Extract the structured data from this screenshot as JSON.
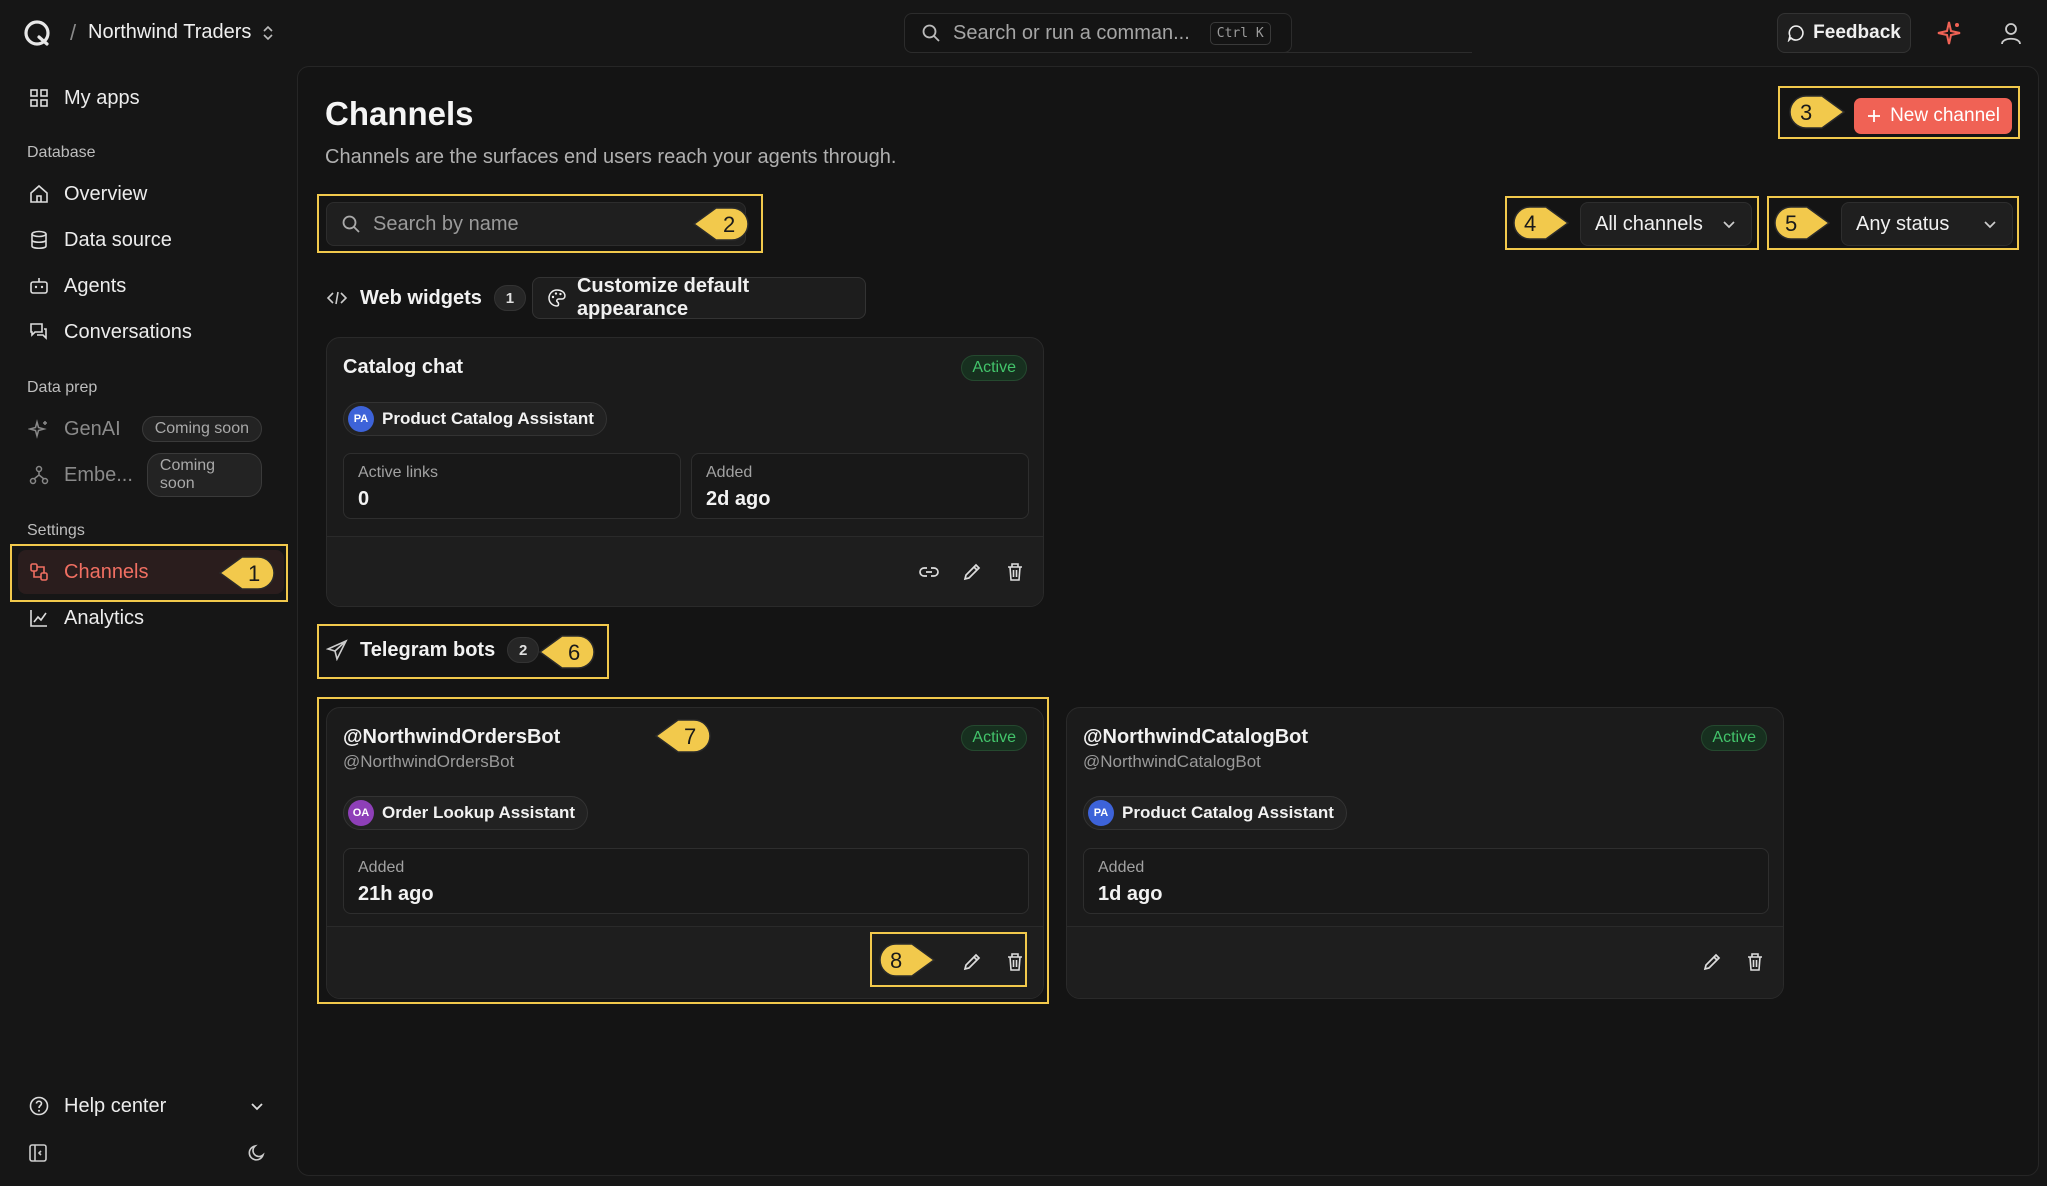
{
  "topbar": {
    "org_name": "Northwind Traders",
    "search_placeholder": "Search or run a comman...",
    "shortcut": "Ctrl K",
    "feedback_label": "Feedback"
  },
  "sidebar": {
    "my_apps": "My apps",
    "sections": {
      "database": "Database",
      "data_prep": "Data prep",
      "settings": "Settings"
    },
    "items": {
      "overview": "Overview",
      "data_source": "Data source",
      "agents": "Agents",
      "conversations": "Conversations",
      "genai": "GenAI",
      "embeddings": "Embe...",
      "channels": "Channels",
      "analytics": "Analytics"
    },
    "coming_soon": "Coming soon",
    "help_center": "Help center"
  },
  "page": {
    "title": "Channels",
    "subtitle": "Channels are the surfaces end users reach your agents through.",
    "new_channel": "New channel",
    "search_placeholder": "Search by name",
    "filter_type": "All channels",
    "filter_status": "Any status"
  },
  "web_widgets": {
    "heading": "Web widgets",
    "count": "1",
    "customize_label": "Customize default appearance",
    "cards": [
      {
        "title": "Catalog chat",
        "status": "Active",
        "agent": "Product Catalog Assistant",
        "agent_initials": "PA",
        "stat1_label": "Active links",
        "stat1_value": "0",
        "stat2_label": "Added",
        "stat2_value": "2d ago"
      }
    ]
  },
  "telegram": {
    "heading": "Telegram bots",
    "count": "2",
    "cards": [
      {
        "title": "@NorthwindOrdersBot",
        "handle": "@NorthwindOrdersBot",
        "status": "Active",
        "agent": "Order Lookup Assistant",
        "agent_initials": "OA",
        "added_label": "Added",
        "added_value": "21h ago"
      },
      {
        "title": "@NorthwindCatalogBot",
        "handle": "@NorthwindCatalogBot",
        "status": "Active",
        "agent": "Product Catalog Assistant",
        "agent_initials": "PA",
        "added_label": "Added",
        "added_value": "1d ago"
      }
    ]
  },
  "annotations": [
    "1",
    "2",
    "3",
    "4",
    "5",
    "6",
    "7",
    "8"
  ],
  "colors": {
    "accent": "#f06255",
    "highlight": "#f2c94c",
    "active_green": "#43c46b",
    "avatar_pa": "#3d63d9",
    "avatar_oa": "#8e3fb8"
  }
}
